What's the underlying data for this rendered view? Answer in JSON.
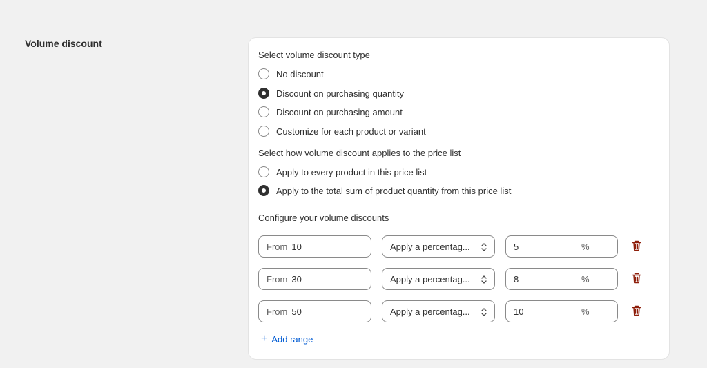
{
  "section": {
    "title": "Volume discount"
  },
  "discount_type": {
    "label": "Select volume discount type",
    "options": [
      {
        "label": "No discount",
        "checked": false
      },
      {
        "label": "Discount on purchasing quantity",
        "checked": true
      },
      {
        "label": "Discount on purchasing amount",
        "checked": false
      },
      {
        "label": "Customize for each product or variant",
        "checked": false
      }
    ]
  },
  "applies_to": {
    "label": "Select how volume discount applies to the price list",
    "options": [
      {
        "label": "Apply to every product in this price list",
        "checked": false
      },
      {
        "label": "Apply to the total sum of product quantity from this price list",
        "checked": true
      }
    ]
  },
  "ranges": {
    "label": "Configure your volume discounts",
    "rows": [
      {
        "from_prefix": "From",
        "from_value": "10",
        "method": "Apply a percentag...",
        "value": "5",
        "suffix": "%"
      },
      {
        "from_prefix": "From",
        "from_value": "30",
        "method": "Apply a percentag...",
        "value": "8",
        "suffix": "%"
      },
      {
        "from_prefix": "From",
        "from_value": "50",
        "method": "Apply a percentag...",
        "value": "10",
        "suffix": "%"
      }
    ],
    "add_label": "Add range"
  },
  "colors": {
    "accent": "#005bd3",
    "delete": "#8e1f0b",
    "text": "#303030",
    "background": "#f1f1f1"
  },
  "icons": {
    "radio": "radio-button",
    "select": "chevron-up-down-icon",
    "delete": "trash-icon",
    "add": "plus-icon"
  }
}
